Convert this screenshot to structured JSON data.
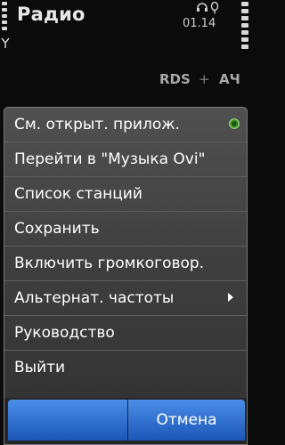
{
  "status_bar": {
    "app_title": "Радио",
    "time": "01.14",
    "icons": [
      "signal-strength-icon",
      "antenna-icon",
      "headset-icon",
      "tone-icon",
      "battery-icon"
    ]
  },
  "radio": {
    "rds_label": "RDS",
    "separator": "+",
    "af_label": "АЧ"
  },
  "menu": {
    "items": [
      {
        "label": "См. открыт. прилож.",
        "indicator": "radio-selected"
      },
      {
        "label": "Перейти в \"Музыка Ovi\""
      },
      {
        "label": "Список станций"
      },
      {
        "label": "Сохранить"
      },
      {
        "label": "Включить громкоговор."
      },
      {
        "label": "Альтернат. частоты",
        "indicator": "submenu"
      },
      {
        "label": "Руководство"
      },
      {
        "label": "Выйти"
      }
    ],
    "cancel_label": "Отмена"
  },
  "colors": {
    "accent": "#2f6fd0",
    "selected_indicator": "#59c33a"
  }
}
